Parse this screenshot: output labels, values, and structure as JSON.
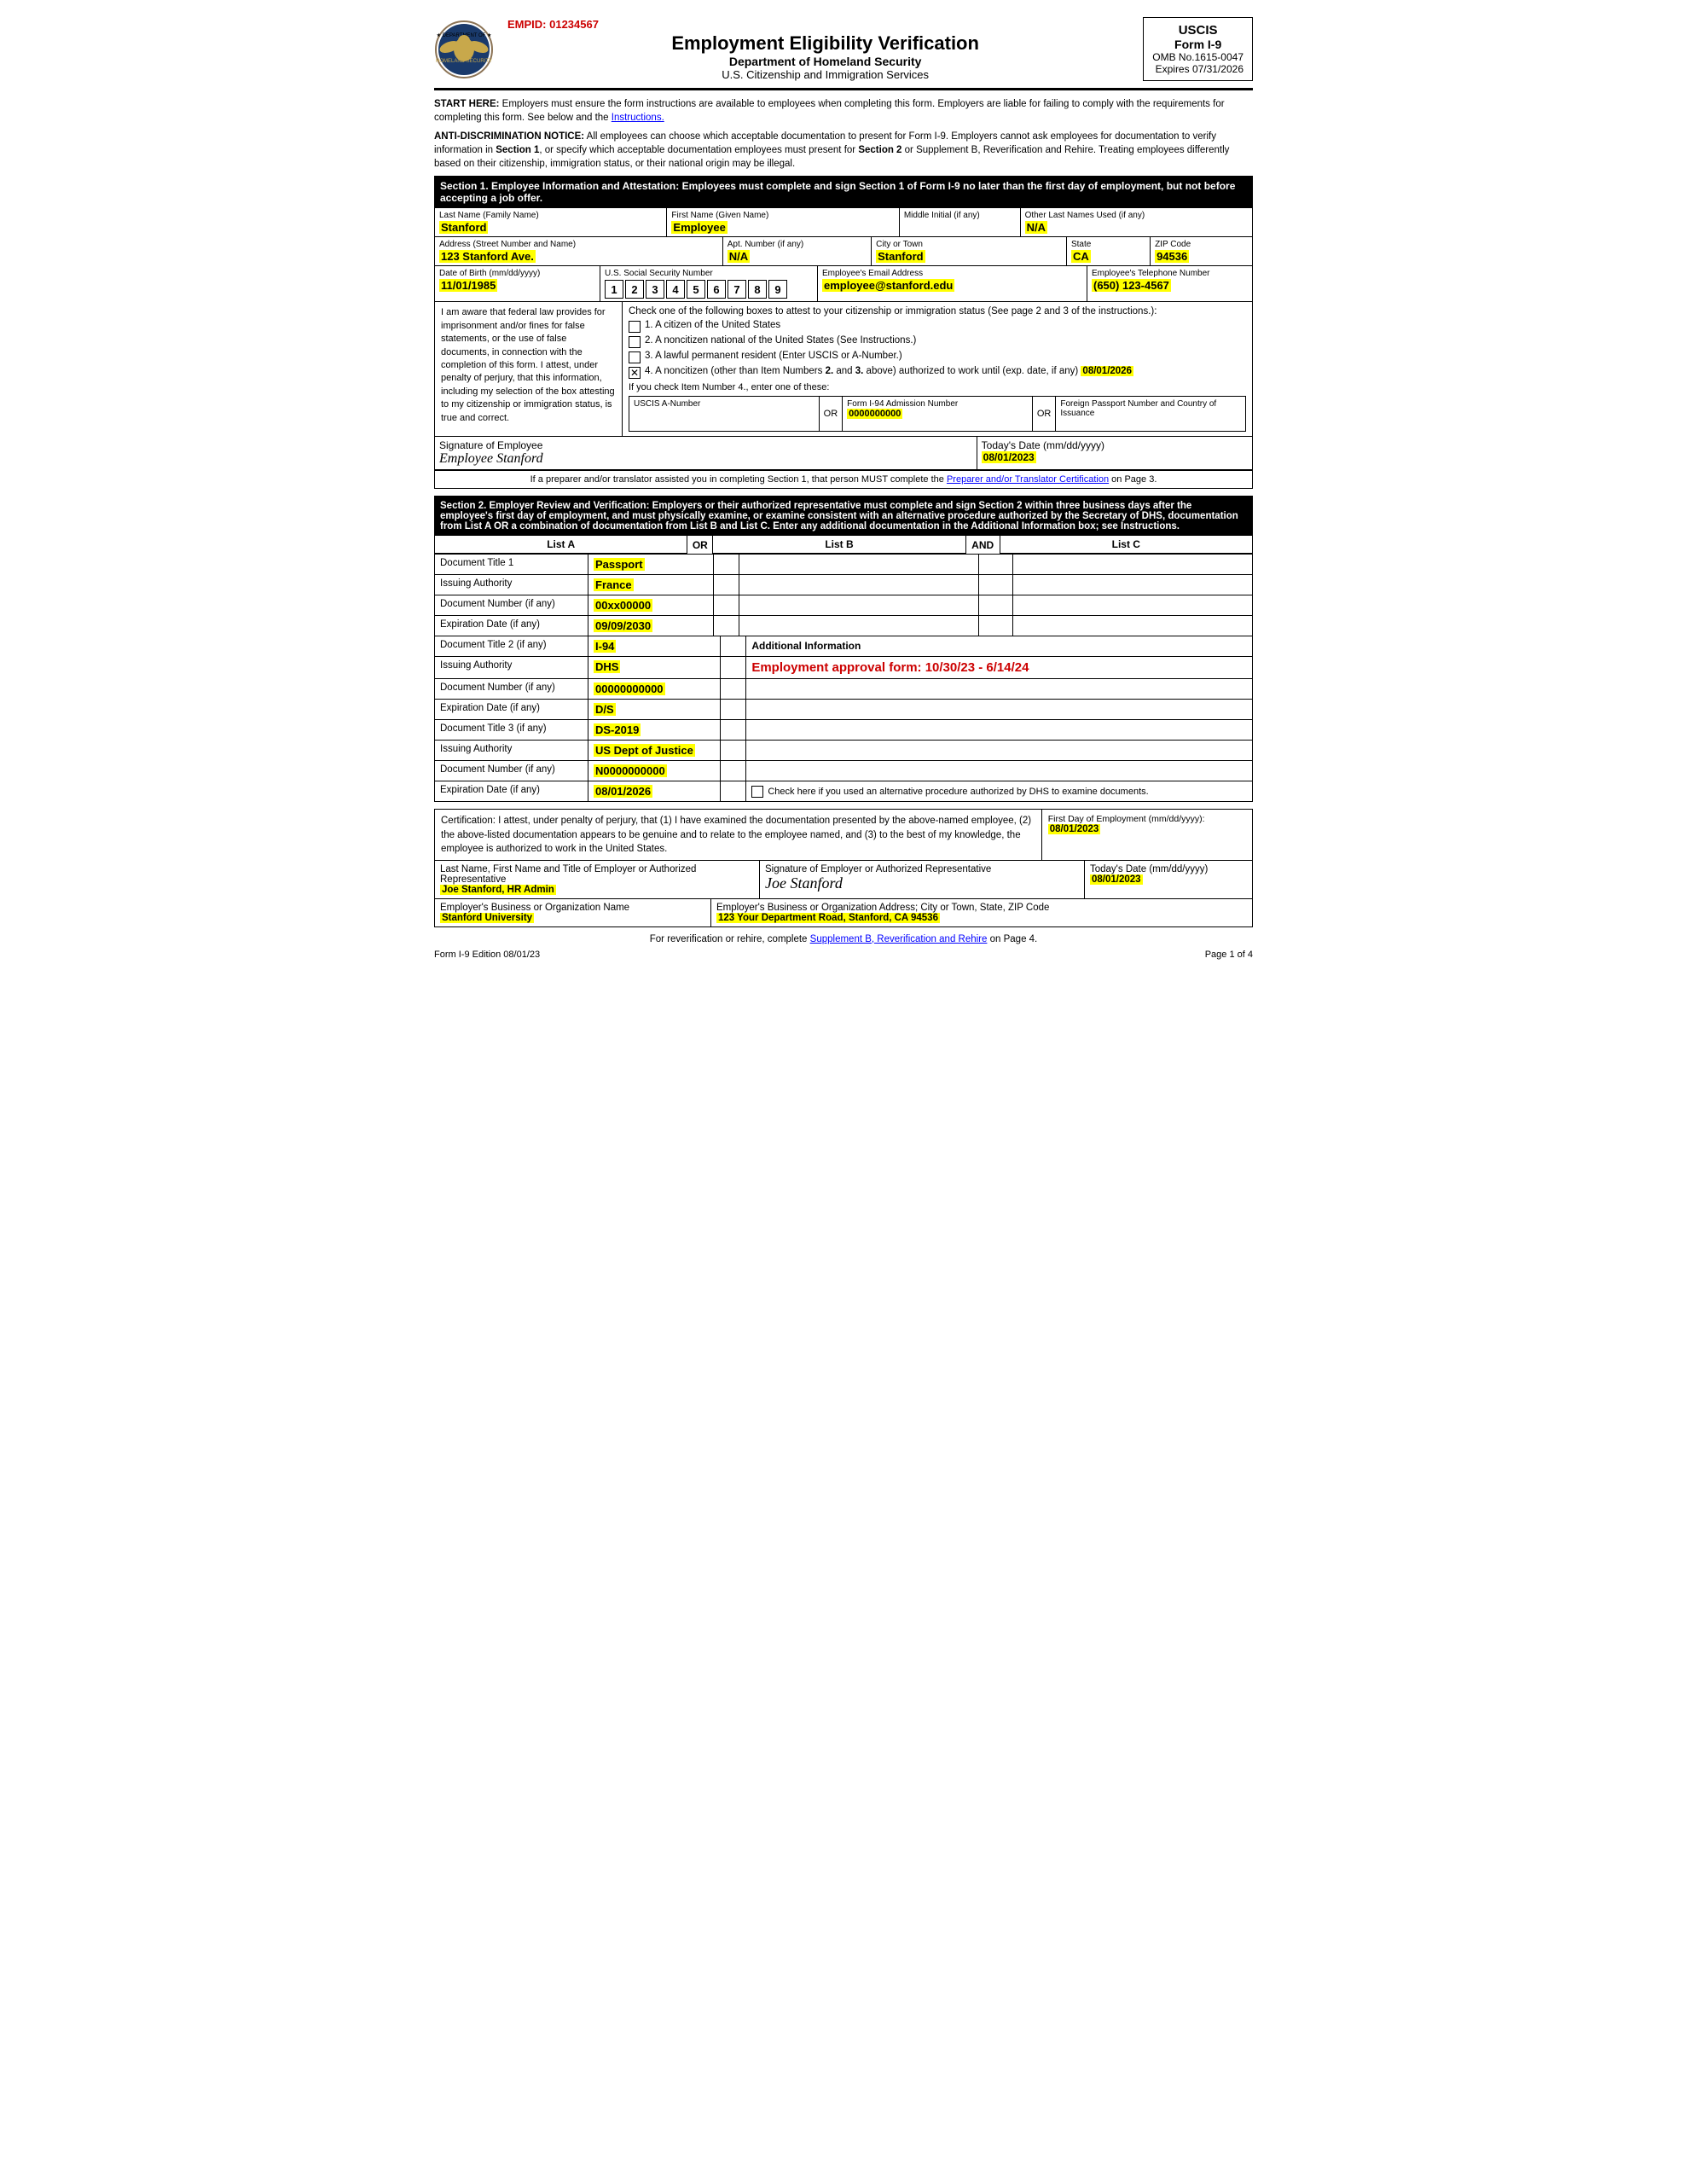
{
  "header": {
    "empid_label": "EMPID: 01234567",
    "title": "Employment Eligibility Verification",
    "dept": "Department of Homeland Security",
    "agency": "U.S. Citizenship and Immigration Services",
    "uscis_label": "USCIS",
    "form_label": "Form I-9",
    "omb_label": "OMB No.1615-0047",
    "expires_label": "Expires 07/31/2026"
  },
  "notices": {
    "start_here": "START HERE:  Employers must ensure the form instructions are available to employees when completing this form.  Employers are liable for failing to comply with the requirements for completing this form.  See below and the Instructions.",
    "anti_discrimination": "ANTI-DISCRIMINATION NOTICE:  All employees can choose which acceptable documentation to present for Form I-9.  Employers cannot ask employees for documentation to verify information in Section 1, or specify which acceptable documentation employees must present for Section 2 or Supplement B, Reverification and Rehire.  Treating employees differently based on their citizenship, immigration status, or their national origin may be illegal."
  },
  "section1": {
    "header": "Section 1. Employee Information and Attestation: Employees must complete and sign Section 1 of Form I-9 no later than the first day of employment, but not before accepting a job offer.",
    "last_name_label": "Last Name (Family Name)",
    "last_name": "Stanford",
    "first_name_label": "First Name (Given Name)",
    "first_name": "Employee",
    "middle_initial_label": "Middle Initial (if any)",
    "middle_initial": "",
    "other_names_label": "Other Last Names Used (if any)",
    "other_names": "N/A",
    "address_label": "Address (Street Number and Name)",
    "address": "123 Stanford Ave.",
    "apt_label": "Apt. Number (if any)",
    "apt": "N/A",
    "city_label": "City or Town",
    "city": "Stanford",
    "state_label": "State",
    "state": "CA",
    "zip_label": "ZIP Code",
    "zip": "94536",
    "dob_label": "Date of Birth (mm/dd/yyyy)",
    "dob": "11/01/1985",
    "ssn_label": "U.S. Social Security Number",
    "ssn_digits": [
      "1",
      "2",
      "3",
      "4",
      "5",
      "6",
      "7",
      "8",
      "9"
    ],
    "email_label": "Employee's Email Address",
    "email": "employee@stanford.edu",
    "phone_label": "Employee's Telephone Number",
    "phone": "(650) 123-4567",
    "awareness_text": "I am aware that federal law provides for imprisonment and/or fines for false statements, or the use of false documents, in connection with the completion of this form.  I attest, under penalty of perjury, that this information, including my selection of the box attesting to my citizenship or immigration status, is true and correct.",
    "citizenship_intro": "Check one of the following boxes to attest to your citizenship or immigration status (See page 2 and 3 of the instructions.):",
    "options": [
      {
        "num": "1",
        "text": "A citizen of the United States",
        "checked": false
      },
      {
        "num": "2",
        "text": "A noncitizen national of the United States (See Instructions.)",
        "checked": false
      },
      {
        "num": "3",
        "text": "A lawful permanent resident (Enter USCIS or A-Number.)",
        "checked": false
      },
      {
        "num": "4",
        "text": "A noncitizen (other than Item Numbers 2. and 3. above) authorized to work until (exp. date, if any)",
        "checked": true
      }
    ],
    "exp_date": "08/01/2026",
    "item4_instruction": "If you check Item Number 4., enter one of these:",
    "uscis_label": "USCIS A-Number",
    "uscis_value": "",
    "i94_label": "Form I-94 Admission Number",
    "i94_value": "0000000000",
    "passport_label": "Foreign Passport Number and Country of Issuance",
    "passport_value": "",
    "sig_label": "Signature of Employee",
    "sig_value": "Employee Stanford",
    "date_label": "Today's Date (mm/dd/yyyy)",
    "date_value": "08/01/2023",
    "preparer_note": "If a preparer and/or translator assisted you in completing Section 1, that person MUST complete the Preparer and/or Translator Certification on Page 3."
  },
  "section2": {
    "header": "Section 2. Employer Review and Verification: Employers or their authorized representative must complete and sign Section 2 within three business days after the employee's first day of employment, and must physically examine, or examine consistent with an alternative procedure authorized by the Secretary of DHS, documentation from List A OR a combination of documentation from List B and List C.  Enter any additional documentation in the Additional Information box; see Instructions.",
    "list_a_header": "List A",
    "or_label": "OR",
    "list_b_header": "List B",
    "and_label": "AND",
    "list_c_header": "List C",
    "doc1_title_label": "Document Title 1",
    "doc1_title": "Passport",
    "issuing_auth_label": "Issuing Authority",
    "doc1_issuing": "France",
    "doc_num_label": "Document Number (if any)",
    "doc1_number": "00xx00000",
    "exp_date_label": "Expiration Date (if any)",
    "doc1_exp": "09/09/2030",
    "doc2_title_label": "Document Title 2 (if any)",
    "doc2_title": "I-94",
    "additional_info_label": "Additional Information",
    "doc2_issuing": "DHS",
    "additional_info_content": "Employment approval form: 10/30/23 - 6/14/24",
    "doc2_number": "00000000000",
    "doc2_exp": "D/S",
    "doc3_title_label": "Document Title 3 (if any)",
    "doc3_title": "DS-2019",
    "doc3_issuing": "US Dept of Justice",
    "doc3_number": "N0000000000",
    "doc3_exp": "08/01/2026",
    "alt_procedure_label": "Check here if you used an alternative procedure authorized by DHS to examine documents."
  },
  "certification": {
    "text": "Certification: I attest, under penalty of perjury, that (1) I have examined the documentation presented by the above-named employee, (2) the above-listed documentation appears to be genuine and to relate to the employee named, and (3) to the best of my knowledge, the employee is authorized to work in the United States.",
    "first_day_label": "First Day of Employment (mm/dd/yyyy):",
    "first_day": "08/01/2023"
  },
  "employer": {
    "rep_label": "Last Name, First Name and Title of Employer or Authorized Representative",
    "rep_name": "Joe Stanford, HR Admin",
    "sig_label": "Signature of Employer or Authorized Representative",
    "sig_value": "Joe Stanford",
    "date_label": "Today's Date (mm/dd/yyyy)",
    "date_value": "08/01/2023",
    "org_label": "Employer's Business or Organization Name",
    "org_name": "Stanford University",
    "address_label": "Employer's Business or Organization Address; City or Town, State, ZIP Code",
    "address": "123 Your Department Road, Stanford, CA 94536"
  },
  "footer": {
    "reverification_note": "For reverification or rehire, complete Supplement B, Reverification and Rehire on Page 4.",
    "form_edition": "Form I-9  Edition  08/01/23",
    "page": "Page 1 of 4"
  }
}
